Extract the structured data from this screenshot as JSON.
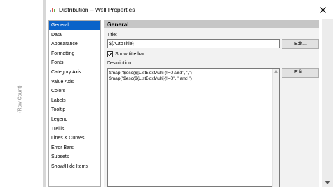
{
  "background": {
    "axis_label": "(Row Count)"
  },
  "window": {
    "title": "Distribution – Well Properties",
    "close_glyph": "✕"
  },
  "nav": {
    "items": [
      {
        "label": "General",
        "selected": true
      },
      {
        "label": "Data"
      },
      {
        "label": "Appearance"
      },
      {
        "label": "Formatting"
      },
      {
        "label": "Fonts"
      },
      {
        "label": "Category Axis"
      },
      {
        "label": "Value Axis"
      },
      {
        "label": "Colors"
      },
      {
        "label": "Labels"
      },
      {
        "label": "Tooltip"
      },
      {
        "label": "Legend"
      },
      {
        "label": "Trellis"
      },
      {
        "label": "Lines & Curves"
      },
      {
        "label": "Error Bars"
      },
      {
        "label": "Subsets"
      },
      {
        "label": "Show/Hide Items"
      }
    ]
  },
  "general": {
    "header": "General",
    "title_label": "Title:",
    "title_value": "${AutoTitle}",
    "edit_label": "Edit...",
    "show_title_bar_label": "Show title bar",
    "show_title_bar_checked": true,
    "description_label": "Description:",
    "description_value": "$map(\"$esc(${ListBoxMulti})!=0 and\", \",\")\n$map(\"$esc(${ListBoxMulti})!=0\", \" and \")",
    "description_edit_label": "Edit..."
  },
  "colors": {
    "selection": "#0a63c9",
    "header_band": "#c6c6c6",
    "panel": "#f2f2f2"
  }
}
